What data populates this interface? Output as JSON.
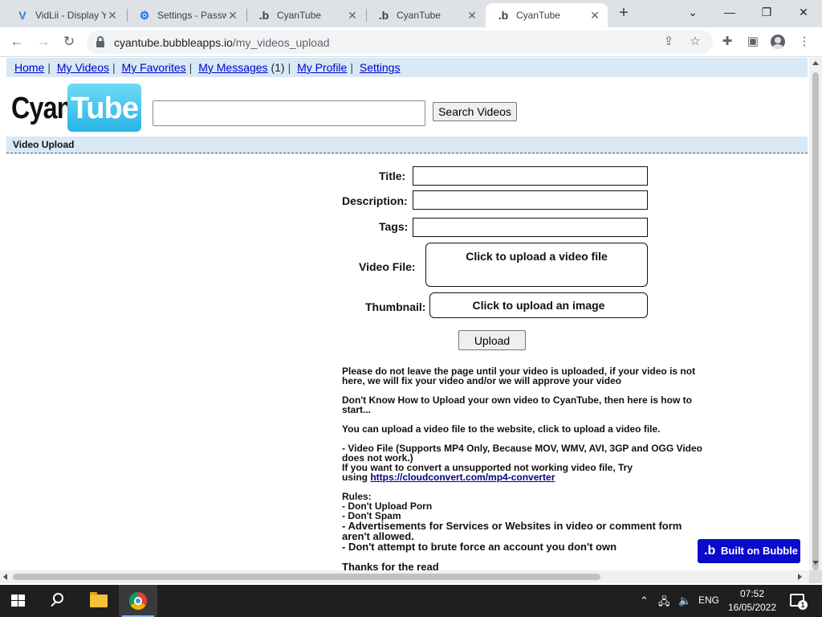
{
  "browser": {
    "tabs": [
      {
        "title": "VidLii - Display Y",
        "icon": "vidlii-icon"
      },
      {
        "title": "Settings - Passw",
        "icon": "gear-icon"
      },
      {
        "title": "CyanTube",
        "icon": "bubble-icon"
      },
      {
        "title": "CyanTube",
        "icon": "bubble-icon"
      },
      {
        "title": "CyanTube",
        "icon": "bubble-icon",
        "active": true
      }
    ],
    "url_host": "cyantube.bubbleapps.io",
    "url_path": "/my_videos_upload"
  },
  "nav": {
    "home": "Home",
    "my_videos": "My Videos",
    "my_favorites": "My Favorites",
    "my_messages": "My Messages",
    "messages_count": "(1)",
    "my_profile": "My Profile",
    "settings": "Settings"
  },
  "logo": {
    "part1": "Cyan",
    "part2": "Tube"
  },
  "search": {
    "button": "Search Videos",
    "value": ""
  },
  "section": {
    "title": "Video Upload"
  },
  "form": {
    "title_label": "Title:",
    "description_label": "Description:",
    "tags_label": "Tags:",
    "video_file_label": "Video File:",
    "video_file_prompt": "Click to upload a video file",
    "thumbnail_label": "Thumbnail:",
    "thumbnail_prompt": "Click to upload an image",
    "upload_button": "Upload"
  },
  "info": {
    "p1": "Please do not leave the page until your video is uploaded, if your video is not here, we will fix your video and/or we will approve your video",
    "p2": "Don't Know How to Upload your own video to CyanTube, then here is how to start...",
    "p3": "You can upload a video file to the website, click to upload a video file.",
    "p4a": "- Video File (Supports MP4 Only, Because MOV, WMV, AVI, 3GP and OGG Video does not work.)",
    "p4b": "If you want to convert a unsupported not working video file, Try",
    "p4c": "using",
    "link": "https://cloudconvert.com/mp4-converter",
    "rules_title": "Rules:",
    "rule1": "- Don't Upload Porn",
    "rule2": "- Don't Spam",
    "rule3": "- Advertisements for Services or Websites in video or comment form aren't allowed.",
    "rule4": "- Don't attempt to brute force an account you don't own",
    "thanks": "Thanks for the read"
  },
  "badge": {
    "text": "Built on Bubble"
  },
  "taskbar": {
    "language": "ENG",
    "time": "07:52",
    "date": "16/05/2022",
    "notifications": "1"
  },
  "colors": {
    "nav_bg": "#d8e8f5",
    "link": "#0000cc",
    "badge_bg": "#0a0acc",
    "logo_cyan": "#28b4e4"
  }
}
